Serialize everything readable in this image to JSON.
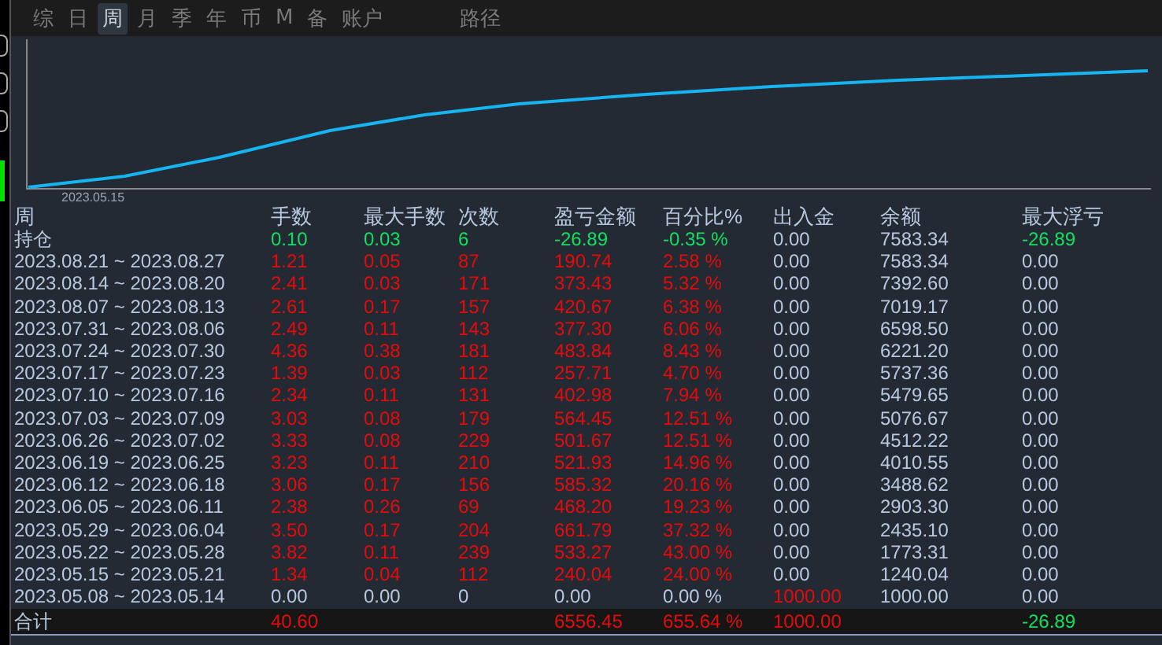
{
  "tabs": [
    {
      "label": "综",
      "selected": false
    },
    {
      "label": "日",
      "selected": false
    },
    {
      "label": "周",
      "selected": true
    },
    {
      "label": "月",
      "selected": false
    },
    {
      "label": "季",
      "selected": false
    },
    {
      "label": "年",
      "selected": false
    },
    {
      "label": "币",
      "selected": false
    },
    {
      "label": "M",
      "selected": false
    },
    {
      "label": "备",
      "selected": false
    },
    {
      "label": "账户",
      "selected": false
    },
    {
      "label": "路径",
      "selected": false
    }
  ],
  "chart": {
    "x_label": "2023.05.15"
  },
  "table": {
    "columns": [
      "周",
      "手数",
      "最大手数",
      "次数",
      "盈亏金额",
      "百分比%",
      "出入金",
      "余额",
      "最大浮亏"
    ],
    "rows": [
      [
        {
          "text": "持仓",
          "color": "#b8c8e0"
        },
        {
          "text": "0.10",
          "color": "#10e060"
        },
        {
          "text": "0.03",
          "color": "#10e060"
        },
        {
          "text": "6",
          "color": "#10e060"
        },
        {
          "text": "-26.89",
          "color": "#10e060"
        },
        {
          "text": "-0.35 %",
          "color": "#10e060"
        },
        {
          "text": "0.00",
          "color": "#b8c8e0"
        },
        {
          "text": "7583.34",
          "color": "#b8c8e0"
        },
        {
          "text": "-26.89",
          "color": "#10e060"
        }
      ],
      [
        {
          "text": "2023.08.21 ~ 2023.08.27",
          "color": "#b8c8e0"
        },
        {
          "text": "1.21",
          "color": "#e60b0b"
        },
        {
          "text": "0.05",
          "color": "#e60b0b"
        },
        {
          "text": "87",
          "color": "#e60b0b"
        },
        {
          "text": "190.74",
          "color": "#e60b0b"
        },
        {
          "text": "2.58 %",
          "color": "#e60b0b"
        },
        {
          "text": "0.00",
          "color": "#b8c8e0"
        },
        {
          "text": "7583.34",
          "color": "#b8c8e0"
        },
        {
          "text": "0.00",
          "color": "#b8c8e0"
        }
      ],
      [
        {
          "text": "2023.08.14 ~ 2023.08.20",
          "color": "#b8c8e0"
        },
        {
          "text": "2.41",
          "color": "#e60b0b"
        },
        {
          "text": "0.03",
          "color": "#e60b0b"
        },
        {
          "text": "171",
          "color": "#e60b0b"
        },
        {
          "text": "373.43",
          "color": "#e60b0b"
        },
        {
          "text": "5.32 %",
          "color": "#e60b0b"
        },
        {
          "text": "0.00",
          "color": "#b8c8e0"
        },
        {
          "text": "7392.60",
          "color": "#b8c8e0"
        },
        {
          "text": "0.00",
          "color": "#b8c8e0"
        }
      ],
      [
        {
          "text": "2023.08.07 ~ 2023.08.13",
          "color": "#b8c8e0"
        },
        {
          "text": "2.61",
          "color": "#e60b0b"
        },
        {
          "text": "0.17",
          "color": "#e60b0b"
        },
        {
          "text": "157",
          "color": "#e60b0b"
        },
        {
          "text": "420.67",
          "color": "#e60b0b"
        },
        {
          "text": "6.38 %",
          "color": "#e60b0b"
        },
        {
          "text": "0.00",
          "color": "#b8c8e0"
        },
        {
          "text": "7019.17",
          "color": "#b8c8e0"
        },
        {
          "text": "0.00",
          "color": "#b8c8e0"
        }
      ],
      [
        {
          "text": "2023.07.31 ~ 2023.08.06",
          "color": "#b8c8e0"
        },
        {
          "text": "2.49",
          "color": "#e60b0b"
        },
        {
          "text": "0.11",
          "color": "#e60b0b"
        },
        {
          "text": "143",
          "color": "#e60b0b"
        },
        {
          "text": "377.30",
          "color": "#e60b0b"
        },
        {
          "text": "6.06 %",
          "color": "#e60b0b"
        },
        {
          "text": "0.00",
          "color": "#b8c8e0"
        },
        {
          "text": "6598.50",
          "color": "#b8c8e0"
        },
        {
          "text": "0.00",
          "color": "#b8c8e0"
        }
      ],
      [
        {
          "text": "2023.07.24 ~ 2023.07.30",
          "color": "#b8c8e0"
        },
        {
          "text": "4.36",
          "color": "#e60b0b"
        },
        {
          "text": "0.38",
          "color": "#e60b0b"
        },
        {
          "text": "181",
          "color": "#e60b0b"
        },
        {
          "text": "483.84",
          "color": "#e60b0b"
        },
        {
          "text": "8.43 %",
          "color": "#e60b0b"
        },
        {
          "text": "0.00",
          "color": "#b8c8e0"
        },
        {
          "text": "6221.20",
          "color": "#b8c8e0"
        },
        {
          "text": "0.00",
          "color": "#b8c8e0"
        }
      ],
      [
        {
          "text": "2023.07.17 ~ 2023.07.23",
          "color": "#b8c8e0"
        },
        {
          "text": "1.39",
          "color": "#e60b0b"
        },
        {
          "text": "0.03",
          "color": "#e60b0b"
        },
        {
          "text": "112",
          "color": "#e60b0b"
        },
        {
          "text": "257.71",
          "color": "#e60b0b"
        },
        {
          "text": "4.70 %",
          "color": "#e60b0b"
        },
        {
          "text": "0.00",
          "color": "#b8c8e0"
        },
        {
          "text": "5737.36",
          "color": "#b8c8e0"
        },
        {
          "text": "0.00",
          "color": "#b8c8e0"
        }
      ],
      [
        {
          "text": "2023.07.10 ~ 2023.07.16",
          "color": "#b8c8e0"
        },
        {
          "text": "2.34",
          "color": "#e60b0b"
        },
        {
          "text": "0.11",
          "color": "#e60b0b"
        },
        {
          "text": "131",
          "color": "#e60b0b"
        },
        {
          "text": "402.98",
          "color": "#e60b0b"
        },
        {
          "text": "7.94 %",
          "color": "#e60b0b"
        },
        {
          "text": "0.00",
          "color": "#b8c8e0"
        },
        {
          "text": "5479.65",
          "color": "#b8c8e0"
        },
        {
          "text": "0.00",
          "color": "#b8c8e0"
        }
      ],
      [
        {
          "text": "2023.07.03 ~ 2023.07.09",
          "color": "#b8c8e0"
        },
        {
          "text": "3.03",
          "color": "#e60b0b"
        },
        {
          "text": "0.08",
          "color": "#e60b0b"
        },
        {
          "text": "179",
          "color": "#e60b0b"
        },
        {
          "text": "564.45",
          "color": "#e60b0b"
        },
        {
          "text": "12.51 %",
          "color": "#e60b0b"
        },
        {
          "text": "0.00",
          "color": "#b8c8e0"
        },
        {
          "text": "5076.67",
          "color": "#b8c8e0"
        },
        {
          "text": "0.00",
          "color": "#b8c8e0"
        }
      ],
      [
        {
          "text": "2023.06.26 ~ 2023.07.02",
          "color": "#b8c8e0"
        },
        {
          "text": "3.33",
          "color": "#e60b0b"
        },
        {
          "text": "0.08",
          "color": "#e60b0b"
        },
        {
          "text": "229",
          "color": "#e60b0b"
        },
        {
          "text": "501.67",
          "color": "#e60b0b"
        },
        {
          "text": "12.51 %",
          "color": "#e60b0b"
        },
        {
          "text": "0.00",
          "color": "#b8c8e0"
        },
        {
          "text": "4512.22",
          "color": "#b8c8e0"
        },
        {
          "text": "0.00",
          "color": "#b8c8e0"
        }
      ],
      [
        {
          "text": "2023.06.19 ~ 2023.06.25",
          "color": "#b8c8e0"
        },
        {
          "text": "3.23",
          "color": "#e60b0b"
        },
        {
          "text": "0.11",
          "color": "#e60b0b"
        },
        {
          "text": "210",
          "color": "#e60b0b"
        },
        {
          "text": "521.93",
          "color": "#e60b0b"
        },
        {
          "text": "14.96 %",
          "color": "#e60b0b"
        },
        {
          "text": "0.00",
          "color": "#b8c8e0"
        },
        {
          "text": "4010.55",
          "color": "#b8c8e0"
        },
        {
          "text": "0.00",
          "color": "#b8c8e0"
        }
      ],
      [
        {
          "text": "2023.06.12 ~ 2023.06.18",
          "color": "#b8c8e0"
        },
        {
          "text": "3.06",
          "color": "#e60b0b"
        },
        {
          "text": "0.17",
          "color": "#e60b0b"
        },
        {
          "text": "156",
          "color": "#e60b0b"
        },
        {
          "text": "585.32",
          "color": "#e60b0b"
        },
        {
          "text": "20.16 %",
          "color": "#e60b0b"
        },
        {
          "text": "0.00",
          "color": "#b8c8e0"
        },
        {
          "text": "3488.62",
          "color": "#b8c8e0"
        },
        {
          "text": "0.00",
          "color": "#b8c8e0"
        }
      ],
      [
        {
          "text": "2023.06.05 ~ 2023.06.11",
          "color": "#b8c8e0"
        },
        {
          "text": "2.38",
          "color": "#e60b0b"
        },
        {
          "text": "0.26",
          "color": "#e60b0b"
        },
        {
          "text": "69",
          "color": "#e60b0b"
        },
        {
          "text": "468.20",
          "color": "#e60b0b"
        },
        {
          "text": "19.23 %",
          "color": "#e60b0b"
        },
        {
          "text": "0.00",
          "color": "#b8c8e0"
        },
        {
          "text": "2903.30",
          "color": "#b8c8e0"
        },
        {
          "text": "0.00",
          "color": "#b8c8e0"
        }
      ],
      [
        {
          "text": "2023.05.29 ~ 2023.06.04",
          "color": "#b8c8e0"
        },
        {
          "text": "3.50",
          "color": "#e60b0b"
        },
        {
          "text": "0.17",
          "color": "#e60b0b"
        },
        {
          "text": "204",
          "color": "#e60b0b"
        },
        {
          "text": "661.79",
          "color": "#e60b0b"
        },
        {
          "text": "37.32 %",
          "color": "#e60b0b"
        },
        {
          "text": "0.00",
          "color": "#b8c8e0"
        },
        {
          "text": "2435.10",
          "color": "#b8c8e0"
        },
        {
          "text": "0.00",
          "color": "#b8c8e0"
        }
      ],
      [
        {
          "text": "2023.05.22 ~ 2023.05.28",
          "color": "#b8c8e0"
        },
        {
          "text": "3.82",
          "color": "#e60b0b"
        },
        {
          "text": "0.11",
          "color": "#e60b0b"
        },
        {
          "text": "239",
          "color": "#e60b0b"
        },
        {
          "text": "533.27",
          "color": "#e60b0b"
        },
        {
          "text": "43.00 %",
          "color": "#e60b0b"
        },
        {
          "text": "0.00",
          "color": "#b8c8e0"
        },
        {
          "text": "1773.31",
          "color": "#b8c8e0"
        },
        {
          "text": "0.00",
          "color": "#b8c8e0"
        }
      ],
      [
        {
          "text": "2023.05.15 ~ 2023.05.21",
          "color": "#b8c8e0"
        },
        {
          "text": "1.34",
          "color": "#e60b0b"
        },
        {
          "text": "0.04",
          "color": "#e60b0b"
        },
        {
          "text": "112",
          "color": "#e60b0b"
        },
        {
          "text": "240.04",
          "color": "#e60b0b"
        },
        {
          "text": "24.00 %",
          "color": "#e60b0b"
        },
        {
          "text": "0.00",
          "color": "#b8c8e0"
        },
        {
          "text": "1240.04",
          "color": "#b8c8e0"
        },
        {
          "text": "0.00",
          "color": "#b8c8e0"
        }
      ],
      [
        {
          "text": "2023.05.08 ~ 2023.05.14",
          "color": "#b8c8e0"
        },
        {
          "text": "0.00",
          "color": "#b8c8e0"
        },
        {
          "text": "0.00",
          "color": "#b8c8e0"
        },
        {
          "text": "0",
          "color": "#b8c8e0"
        },
        {
          "text": "0.00",
          "color": "#b8c8e0"
        },
        {
          "text": "0.00 %",
          "color": "#b8c8e0"
        },
        {
          "text": "1000.00",
          "color": "#e60b0b"
        },
        {
          "text": "1000.00",
          "color": "#b8c8e0"
        },
        {
          "text": "0.00",
          "color": "#b8c8e0"
        }
      ]
    ],
    "total": {
      "label": {
        "text": "合计",
        "color": "#b8c8e0"
      },
      "lots": {
        "text": "40.60",
        "color": "#e60b0b"
      },
      "profit": {
        "text": "6556.45",
        "color": "#e60b0b"
      },
      "percent": {
        "text": "655.64 %",
        "color": "#e60b0b"
      },
      "deposit": {
        "text": "1000.00",
        "color": "#e60b0b"
      },
      "max_floating_loss": {
        "text": "-26.89",
        "color": "#10e060"
      }
    }
  }
}
